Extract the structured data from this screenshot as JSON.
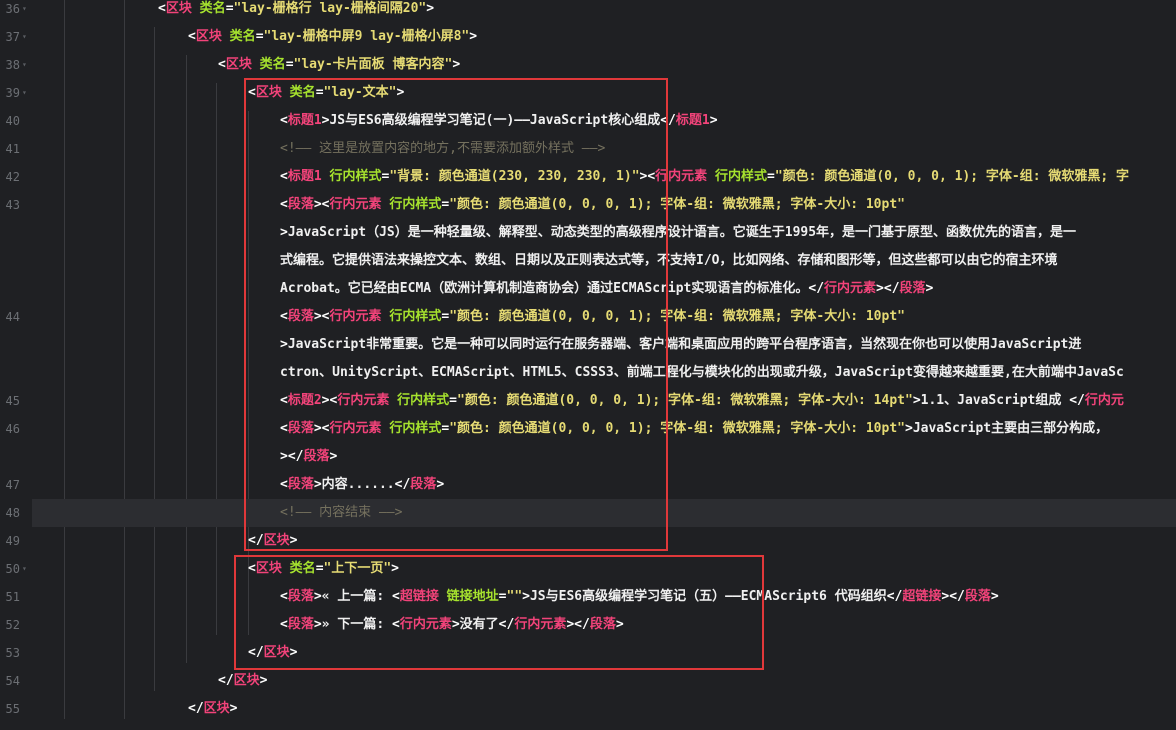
{
  "editor": {
    "lines": [
      {
        "num": "36",
        "fold": "▾",
        "indent": 158,
        "tokens": [
          [
            "br",
            "<"
          ],
          [
            "tag",
            "区块"
          ],
          [
            "txt",
            " "
          ],
          [
            "attr",
            "类名"
          ],
          [
            "br",
            "="
          ],
          [
            "str",
            "\"lay-栅格行 lay-栅格间隔20\""
          ],
          [
            "br",
            ">"
          ]
        ]
      },
      {
        "num": "37",
        "fold": "▾",
        "indent": 188,
        "tokens": [
          [
            "br",
            "<"
          ],
          [
            "tag",
            "区块"
          ],
          [
            "txt",
            " "
          ],
          [
            "attr",
            "类名"
          ],
          [
            "br",
            "="
          ],
          [
            "str",
            "\"lay-栅格中屏9 lay-栅格小屏8\""
          ],
          [
            "br",
            ">"
          ]
        ]
      },
      {
        "num": "38",
        "fold": "▾",
        "indent": 218,
        "tokens": [
          [
            "br",
            "<"
          ],
          [
            "tag",
            "区块"
          ],
          [
            "txt",
            " "
          ],
          [
            "attr",
            "类名"
          ],
          [
            "br",
            "="
          ],
          [
            "str",
            "\"lay-卡片面板 博客内容\""
          ],
          [
            "br",
            ">"
          ]
        ]
      },
      {
        "num": "39",
        "fold": "▾",
        "indent": 248,
        "tokens": [
          [
            "br",
            "<"
          ],
          [
            "tag",
            "区块"
          ],
          [
            "txt",
            " "
          ],
          [
            "attr",
            "类名"
          ],
          [
            "br",
            "="
          ],
          [
            "str",
            "\"lay-文本\""
          ],
          [
            "br",
            ">"
          ]
        ]
      },
      {
        "num": "40",
        "fold": "",
        "indent": 280,
        "tokens": [
          [
            "br",
            "<"
          ],
          [
            "tag",
            "标题1"
          ],
          [
            "br",
            ">"
          ],
          [
            "txt",
            "JS与ES6高级编程学习笔记(一)——JavaScript核心组成"
          ],
          [
            "br",
            "</"
          ],
          [
            "tag",
            "标题1"
          ],
          [
            "br",
            ">"
          ]
        ]
      },
      {
        "num": "41",
        "fold": "",
        "indent": 280,
        "tokens": [
          [
            "cmt",
            "<!—— 这里是放置内容的地方,不需要添加额外样式 ——>"
          ]
        ]
      },
      {
        "num": "42",
        "fold": "",
        "indent": 280,
        "tokens": [
          [
            "br",
            "<"
          ],
          [
            "tag",
            "标题1"
          ],
          [
            "txt",
            " "
          ],
          [
            "attr",
            "行内样式"
          ],
          [
            "br",
            "="
          ],
          [
            "str",
            "\"背景: 颜色通道(230, 230, 230, 1)\""
          ],
          [
            "br",
            ">"
          ],
          [
            "br",
            "<"
          ],
          [
            "tag",
            "行内元素"
          ],
          [
            "txt",
            " "
          ],
          [
            "attr",
            "行内样式"
          ],
          [
            "br",
            "="
          ],
          [
            "str",
            "\"颜色: 颜色通道(0, 0, 0, 1); 字体-组: 微软雅黑; 字"
          ]
        ]
      },
      {
        "num": "43",
        "fold": "",
        "indent": 280,
        "tokens": [
          [
            "br",
            "<"
          ],
          [
            "tag",
            "段落"
          ],
          [
            "br",
            "><"
          ],
          [
            "tag",
            "行内元素"
          ],
          [
            "txt",
            " "
          ],
          [
            "attr",
            "行内样式"
          ],
          [
            "br",
            "="
          ],
          [
            "str",
            "\"颜色: 颜色通道(0, 0, 0, 1); 字体-组: 微软雅黑; 字体-大小: 10pt\""
          ]
        ]
      },
      {
        "num": "",
        "fold": "",
        "indent": 280,
        "tokens": [
          [
            "br",
            ">"
          ],
          [
            "txt",
            "JavaScript（JS）是一种轻量级、解释型、动态类型的高级程序设计语言。它诞生于1995年，是一门基于原型、函数优先的语言，是一"
          ]
        ]
      },
      {
        "num": "",
        "fold": "",
        "indent": 280,
        "tokens": [
          [
            "txt",
            "式编程。它提供语法来操控文本、数组、日期以及正则表达式等，不支持I/O，比如网络、存储和图形等，但这些都可以由它的宿主环境"
          ]
        ]
      },
      {
        "num": "",
        "fold": "",
        "indent": 280,
        "tokens": [
          [
            "txt",
            "Acrobat。它已经由ECMA（欧洲计算机制造商协会）通过ECMAScript实现语言的标准化。"
          ],
          [
            "br",
            "</"
          ],
          [
            "tag",
            "行内元素"
          ],
          [
            "br",
            "></"
          ],
          [
            "tag",
            "段落"
          ],
          [
            "br",
            ">"
          ]
        ]
      },
      {
        "num": "44",
        "fold": "",
        "indent": 280,
        "tokens": [
          [
            "br",
            "<"
          ],
          [
            "tag",
            "段落"
          ],
          [
            "br",
            "><"
          ],
          [
            "tag",
            "行内元素"
          ],
          [
            "txt",
            " "
          ],
          [
            "attr",
            "行内样式"
          ],
          [
            "br",
            "="
          ],
          [
            "str",
            "\"颜色: 颜色通道(0, 0, 0, 1); 字体-组: 微软雅黑; 字体-大小: 10pt\""
          ]
        ]
      },
      {
        "num": "",
        "fold": "",
        "indent": 280,
        "tokens": [
          [
            "br",
            ">"
          ],
          [
            "txt",
            "JavaScript非常重要。它是一种可以同时运行在服务器端、客户端和桌面应用的跨平台程序语言，当然现在你也可以使用JavaScript进"
          ]
        ]
      },
      {
        "num": "",
        "fold": "",
        "indent": 280,
        "tokens": [
          [
            "txt",
            "ctron、UnityScript、ECMAScript、HTML5、CSSS3、前端工程化与模块化的出现或升级，JavaScript变得越来越重要,在大前端中JavaSc"
          ]
        ]
      },
      {
        "num": "45",
        "fold": "",
        "indent": 280,
        "tokens": [
          [
            "br",
            "<"
          ],
          [
            "tag",
            "标题2"
          ],
          [
            "br",
            "><"
          ],
          [
            "tag",
            "行内元素"
          ],
          [
            "txt",
            " "
          ],
          [
            "attr",
            "行内样式"
          ],
          [
            "br",
            "="
          ],
          [
            "str",
            "\"颜色: 颜色通道(0, 0, 0, 1); 字体-组: 微软雅黑; 字体-大小: 14pt\""
          ],
          [
            "br",
            ">"
          ],
          [
            "txt",
            "1.1、JavaScript组成 "
          ],
          [
            "br",
            "</"
          ],
          [
            "tag",
            "行内元"
          ]
        ]
      },
      {
        "num": "46",
        "fold": "",
        "indent": 280,
        "tokens": [
          [
            "br",
            "<"
          ],
          [
            "tag",
            "段落"
          ],
          [
            "br",
            "><"
          ],
          [
            "tag",
            "行内元素"
          ],
          [
            "txt",
            " "
          ],
          [
            "attr",
            "行内样式"
          ],
          [
            "br",
            "="
          ],
          [
            "str",
            "\"颜色: 颜色通道(0, 0, 0, 1); 字体-组: 微软雅黑; 字体-大小: 10pt\""
          ],
          [
            "br",
            ">"
          ],
          [
            "txt",
            "JavaScript主要由三部分构成，"
          ]
        ]
      },
      {
        "num": "",
        "fold": "",
        "indent": 280,
        "tokens": [
          [
            "br",
            "></"
          ],
          [
            "tag",
            "段落"
          ],
          [
            "br",
            ">"
          ]
        ]
      },
      {
        "num": "47",
        "fold": "",
        "indent": 280,
        "tokens": [
          [
            "br",
            "<"
          ],
          [
            "tag",
            "段落"
          ],
          [
            "br",
            ">"
          ],
          [
            "txt",
            "内容......"
          ],
          [
            "br",
            "</"
          ],
          [
            "tag",
            "段落"
          ],
          [
            "br",
            ">"
          ]
        ]
      },
      {
        "num": "48",
        "fold": "",
        "indent": 280,
        "active": true,
        "tokens": [
          [
            "cmt",
            "<!—— 内容结束 ——>"
          ]
        ]
      },
      {
        "num": "49",
        "fold": "",
        "indent": 248,
        "tokens": [
          [
            "br",
            "</"
          ],
          [
            "tag",
            "区块"
          ],
          [
            "br",
            ">"
          ]
        ]
      },
      {
        "num": "50",
        "fold": "▾",
        "indent": 248,
        "tokens": [
          [
            "br",
            "<"
          ],
          [
            "tag",
            "区块"
          ],
          [
            "txt",
            " "
          ],
          [
            "attr",
            "类名"
          ],
          [
            "br",
            "="
          ],
          [
            "str",
            "\"上下一页\""
          ],
          [
            "br",
            ">"
          ]
        ]
      },
      {
        "num": "51",
        "fold": "",
        "indent": 280,
        "tokens": [
          [
            "br",
            "<"
          ],
          [
            "tag",
            "段落"
          ],
          [
            "br",
            ">"
          ],
          [
            "txt",
            "« 上一篇: "
          ],
          [
            "br",
            "<"
          ],
          [
            "tag",
            "超链接"
          ],
          [
            "txt",
            " "
          ],
          [
            "attr",
            "链接地址"
          ],
          [
            "br",
            "="
          ],
          [
            "str",
            "\"\""
          ],
          [
            "br",
            ">"
          ],
          [
            "txt",
            "JS与ES6高级编程学习笔记（五）——ECMAScript6 代码组织"
          ],
          [
            "br",
            "</"
          ],
          [
            "tag",
            "超链接"
          ],
          [
            "br",
            "></"
          ],
          [
            "tag",
            "段落"
          ],
          [
            "br",
            ">"
          ]
        ]
      },
      {
        "num": "52",
        "fold": "",
        "indent": 280,
        "tokens": [
          [
            "br",
            "<"
          ],
          [
            "tag",
            "段落"
          ],
          [
            "br",
            ">"
          ],
          [
            "txt",
            "» 下一篇: "
          ],
          [
            "br",
            "<"
          ],
          [
            "tag",
            "行内元素"
          ],
          [
            "br",
            ">"
          ],
          [
            "txt",
            "没有了"
          ],
          [
            "br",
            "</"
          ],
          [
            "tag",
            "行内元素"
          ],
          [
            "br",
            "></"
          ],
          [
            "tag",
            "段落"
          ],
          [
            "br",
            ">"
          ]
        ]
      },
      {
        "num": "53",
        "fold": "",
        "indent": 248,
        "tokens": [
          [
            "br",
            "</"
          ],
          [
            "tag",
            "区块"
          ],
          [
            "br",
            ">"
          ]
        ]
      },
      {
        "num": "54",
        "fold": "",
        "indent": 218,
        "tokens": [
          [
            "br",
            "</"
          ],
          [
            "tag",
            "区块"
          ],
          [
            "br",
            ">"
          ]
        ]
      },
      {
        "num": "55",
        "fold": "",
        "indent": 188,
        "tokens": [
          [
            "br",
            "</"
          ],
          [
            "tag",
            "区块"
          ],
          [
            "br",
            ">"
          ]
        ]
      }
    ]
  },
  "colors": {
    "background": "#1f2023",
    "active_line": "#2c2d31",
    "tag": "#f2437a",
    "attribute": "#a6e22e",
    "string": "#e6db74",
    "comment": "#75715e",
    "highlight_box": "#e0383a"
  }
}
